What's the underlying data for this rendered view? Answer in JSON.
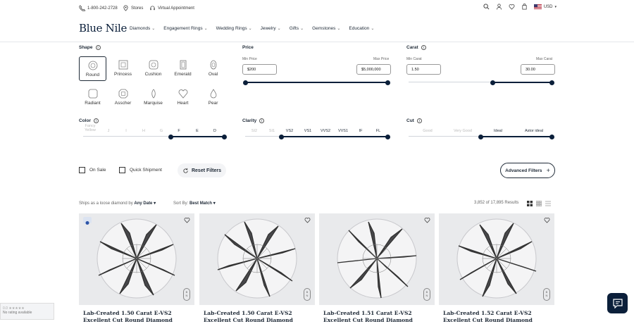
{
  "topbar": {
    "phone": "1-800-242-2728",
    "stores": "Stores",
    "virtual": "Virtual Appointment",
    "currency": "USD"
  },
  "brand": "Blue Nile",
  "menu": [
    "Diamonds",
    "Engagement Rings",
    "Wedding Rings",
    "Jewelry",
    "Gifts",
    "Gemstones",
    "Education"
  ],
  "shape": {
    "label": "Shape",
    "items": [
      "Round",
      "Princess",
      "Cushion",
      "Emerald",
      "Oval",
      "Radiant",
      "Asscher",
      "Marquise",
      "Heart",
      "Pear"
    ],
    "selected": "Round"
  },
  "price": {
    "label": "Price",
    "min_label": "Min Price",
    "max_label": "Max Price",
    "min": "$200",
    "max": "$5,000,000"
  },
  "carat": {
    "label": "Carat",
    "min_label": "Min Carat",
    "max_label": "Max Carat",
    "min": "1.50",
    "max": "30.00"
  },
  "color": {
    "label": "Color",
    "grades": [
      "Fancy Yellow",
      "J",
      "I",
      "H",
      "G",
      "F",
      "E",
      "D"
    ],
    "selected_from": "F",
    "selected_to": "D"
  },
  "clarity": {
    "label": "Clarity",
    "grades": [
      "SI2",
      "SI1",
      "VS2",
      "VS1",
      "VVS2",
      "VVS1",
      "IF",
      "FL"
    ],
    "selected_from": "VS2",
    "selected_to": "FL"
  },
  "cut": {
    "label": "Cut",
    "grades": [
      "Good",
      "Very Good",
      "Ideal",
      "Astor ideal"
    ],
    "selected_from": "Ideal",
    "selected_to": "Astor ideal"
  },
  "filters": {
    "on_sale": "On Sale",
    "quick_shipment": "Quick Shipment",
    "reset": "Reset Filters",
    "advanced": "Advanced Filters"
  },
  "sort": {
    "ships_label": "Ships as a loose diamond by",
    "ships_value": "Any Date",
    "sort_label": "Sort By:",
    "sort_value": "Best Match",
    "results": "3,852 of 17,895 Results"
  },
  "products": [
    {
      "title": "Lab-Created 1.50 Carat E-VS2 Excellent Cut Round Diamond"
    },
    {
      "title": "Lab-Created 1.50 Carat E-VS2 Excellent Cut Round Diamond"
    },
    {
      "title": "Lab-Created 1.51 Carat E-VS2 Excellent Cut Round Diamond"
    },
    {
      "title": "Lab-Created 1.52 Carat E-VS2 Excellent Cut Round Diamond"
    }
  ],
  "rating": {
    "stars": "0.0 ★★★★★",
    "text": "No rating available"
  },
  "colors": {
    "navy": "#0b1f3a"
  }
}
